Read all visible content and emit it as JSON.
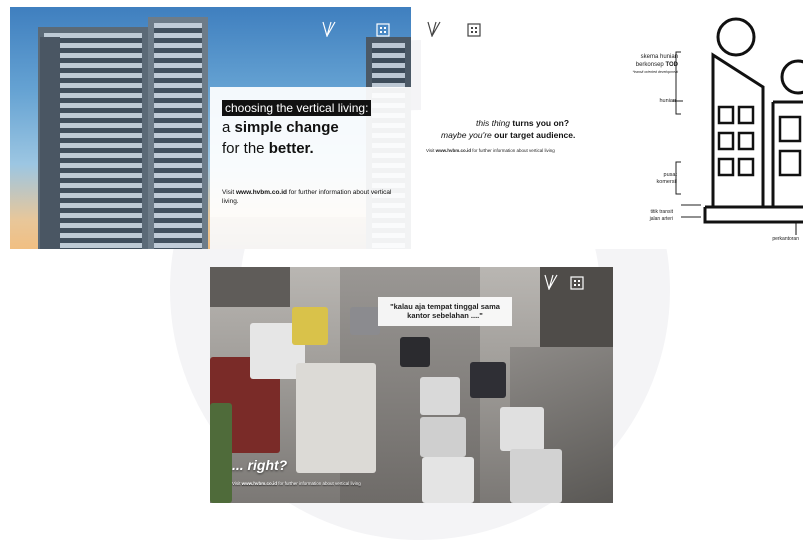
{
  "panel1": {
    "line1": "choosing the vertical living:",
    "line2_prefix": "a ",
    "line2_bold": "simple change",
    "line3_prefix": "for the ",
    "line3_bold": "better.",
    "visit_prefix": "Visit ",
    "visit_url": "www.hvbm.co.id",
    "visit_suffix": " for further information about vertical living."
  },
  "panel2": {
    "tagline_part1": "this thing ",
    "tagline_bold1": "turns you on?",
    "tagline_part2": "maybe you're ",
    "tagline_bold2": "our target audience.",
    "visit_prefix": "Visit ",
    "visit_url": "www.hvbm.co.id",
    "visit_suffix": " for further information about vertical living",
    "labels": {
      "skema1": "skema hunian",
      "skema2_prefix": "berkonsep ",
      "skema2_bold": "TOD",
      "skema3": "*transit oriented development",
      "hunian": "hunian",
      "pusat": "pusat",
      "komersil": "komersil",
      "titik_transit": "titik transit",
      "jalan_arteri": "jalan arteri",
      "perkantoran": "perkantoran"
    }
  },
  "panel3": {
    "quote": "\"kalau aja tempat tinggal sama kantor sebelahan ....\"",
    "right": "... right?",
    "visit_prefix": "Visit ",
    "visit_url": "www.hvbm.co.id",
    "visit_suffix": " for further information about vertical living"
  }
}
